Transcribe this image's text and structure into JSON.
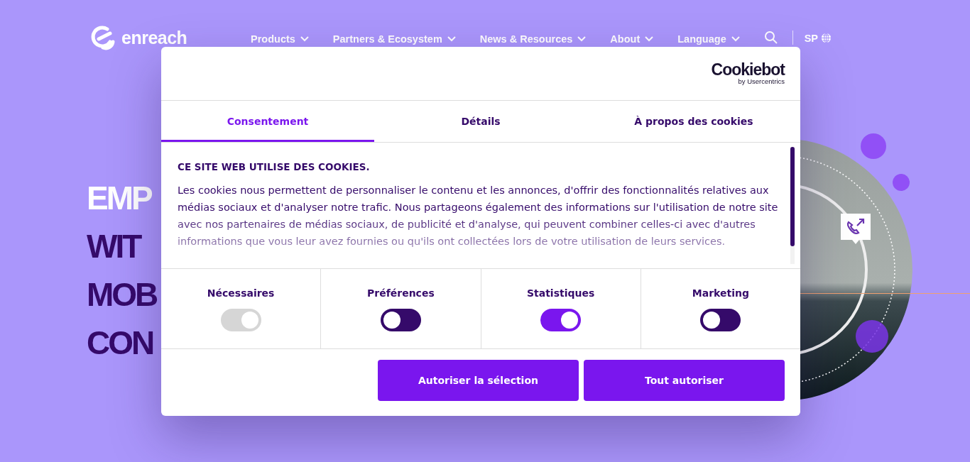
{
  "header": {
    "logo": "enreach",
    "nav": [
      {
        "label": "Products"
      },
      {
        "label": "Partners & Ecosystem"
      },
      {
        "label": "News & Resources"
      },
      {
        "label": "About"
      },
      {
        "label": "Language"
      }
    ],
    "region": "SP"
  },
  "hero": {
    "lines": [
      {
        "text": "EMP",
        "highlighted": true
      },
      {
        "text": "WIT",
        "highlighted": false
      },
      {
        "text": "MOB",
        "highlighted": false
      },
      {
        "text": "CON",
        "highlighted": false
      }
    ]
  },
  "dialog": {
    "brand": "Cookiebot",
    "brand_sub": "by Usercentrics",
    "tabs": [
      {
        "label": "Consentement",
        "selected": true
      },
      {
        "label": "Détails",
        "selected": false
      },
      {
        "label": "À propos des cookies",
        "selected": false
      }
    ],
    "heading": "CE SITE WEB UTILISE DES COOKIES.",
    "text": "Les cookies nous permettent de personnaliser le contenu et les annonces, d'offrir des fonctionnalités relatives aux médias sociaux et d'analyser notre trafic. Nous partageons également des informations sur l'utilisation de notre site avec nos partenaires de médias sociaux, de publicité et d'analyse, qui peuvent combiner celles-ci avec d'autres informations que vous leur avez fournies ou qu'ils ont collectées lors de votre utilisation de leurs services.",
    "toggles": [
      {
        "label": "Nécessaires",
        "on": true,
        "disabled": true
      },
      {
        "label": "Préférences",
        "on": false,
        "disabled": false
      },
      {
        "label": "Statistiques",
        "on": true,
        "disabled": false
      },
      {
        "label": "Marketing",
        "on": false,
        "disabled": false
      }
    ],
    "buttons": [
      {
        "label": "Autoriser la sélection"
      },
      {
        "label": "Tout autoriser"
      }
    ]
  }
}
